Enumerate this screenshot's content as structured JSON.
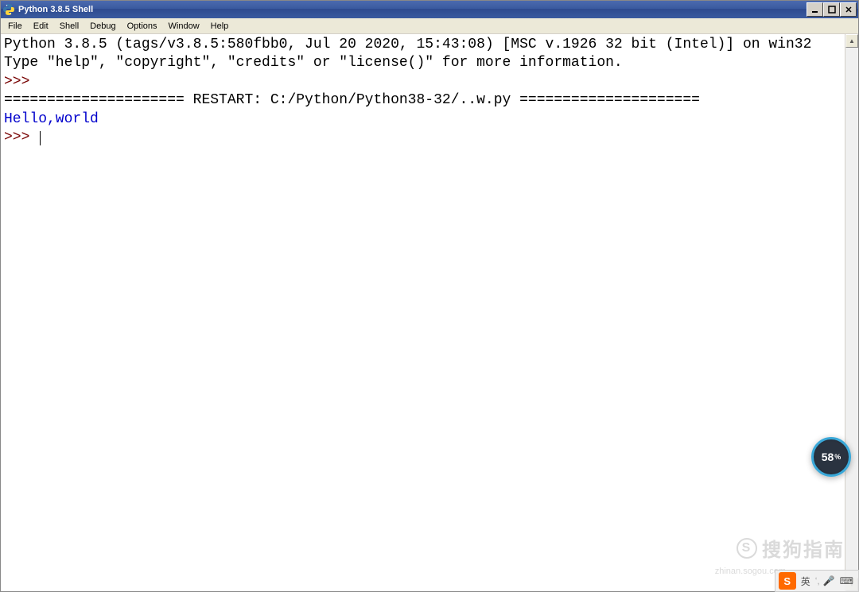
{
  "window": {
    "title": "Python 3.8.5 Shell"
  },
  "menu": {
    "items": [
      "File",
      "Edit",
      "Shell",
      "Debug",
      "Options",
      "Window",
      "Help"
    ]
  },
  "shell": {
    "banner_line1": "Python 3.8.5 (tags/v3.8.5:580fbb0, Jul 20 2020, 15:43:08) [MSC v.1926 32 bit (Intel)] on win32",
    "banner_line2": "Type \"help\", \"copyright\", \"credits\" or \"license()\" for more information.",
    "prompt": ">>> ",
    "restart_line": "===================== RESTART: C:/Python/Python38-32/..w.py =====================",
    "output": "Hello,world"
  },
  "overlay": {
    "badge_value": "58",
    "badge_unit": "%"
  },
  "watermark": {
    "text": "搜狗指南",
    "sub": "zhinan.sogou.com"
  },
  "ime": {
    "logo": "S",
    "lang": "英",
    "punct": "‘,",
    "mic": "🎤",
    "kbd": "⌨"
  }
}
